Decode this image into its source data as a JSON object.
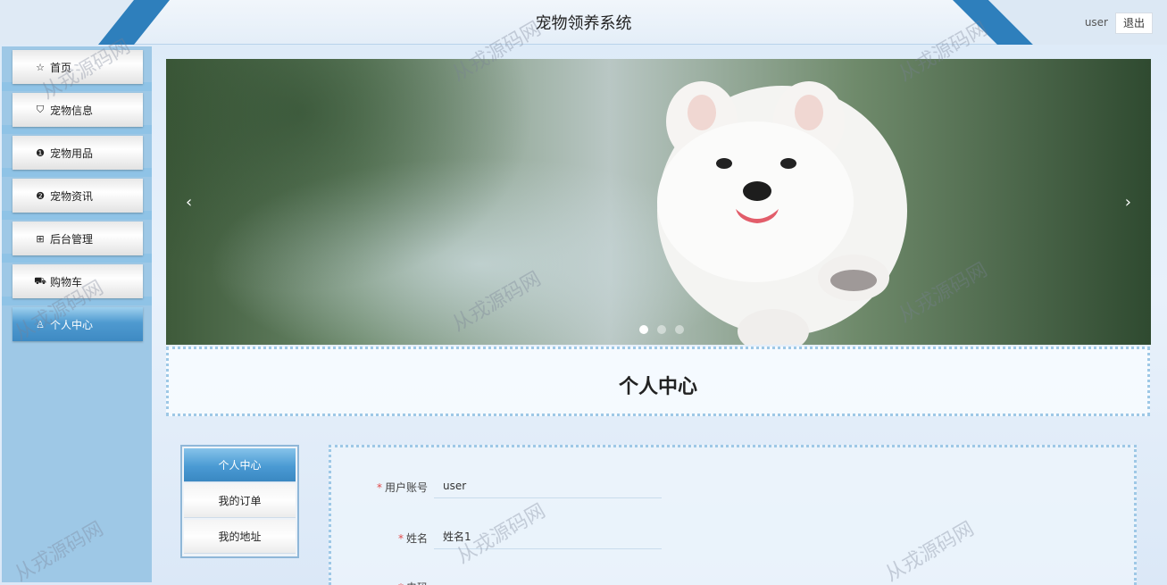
{
  "header": {
    "title": "宠物领养系统",
    "user": "user",
    "logout_label": "退出"
  },
  "sidebar": {
    "items": [
      {
        "label": "首页",
        "icon": "star-icon",
        "glyph": "☆"
      },
      {
        "label": "宠物信息",
        "icon": "bag-icon",
        "glyph": "⛉"
      },
      {
        "label": "宠物用品",
        "icon": "info-icon",
        "glyph": "❶"
      },
      {
        "label": "宠物资讯",
        "icon": "question-icon",
        "glyph": "❷"
      },
      {
        "label": "后台管理",
        "icon": "package-icon",
        "glyph": "⊞"
      },
      {
        "label": "购物车",
        "icon": "cart-icon",
        "glyph": "⛟"
      },
      {
        "label": "个人中心",
        "icon": "user-icon",
        "glyph": "♙"
      }
    ],
    "active_index": 6
  },
  "banner": {
    "prev": "‹",
    "next": "›",
    "slide_count": 3,
    "active_slide": 1
  },
  "section_title": "个人中心",
  "sub_menu": {
    "items": [
      "个人中心",
      "我的订单",
      "我的地址"
    ],
    "active_index": 0
  },
  "form": {
    "fields": [
      {
        "label": "用户账号",
        "value": "user",
        "required": true
      },
      {
        "label": "姓名",
        "value": "姓名1",
        "required": true
      },
      {
        "label": "电码",
        "value": "",
        "required": true
      }
    ]
  },
  "watermark": "从戎源码网",
  "colors": {
    "accent": "#3e8ac3",
    "sidebar": "#9ec8e6",
    "required": "#e14a4a"
  }
}
